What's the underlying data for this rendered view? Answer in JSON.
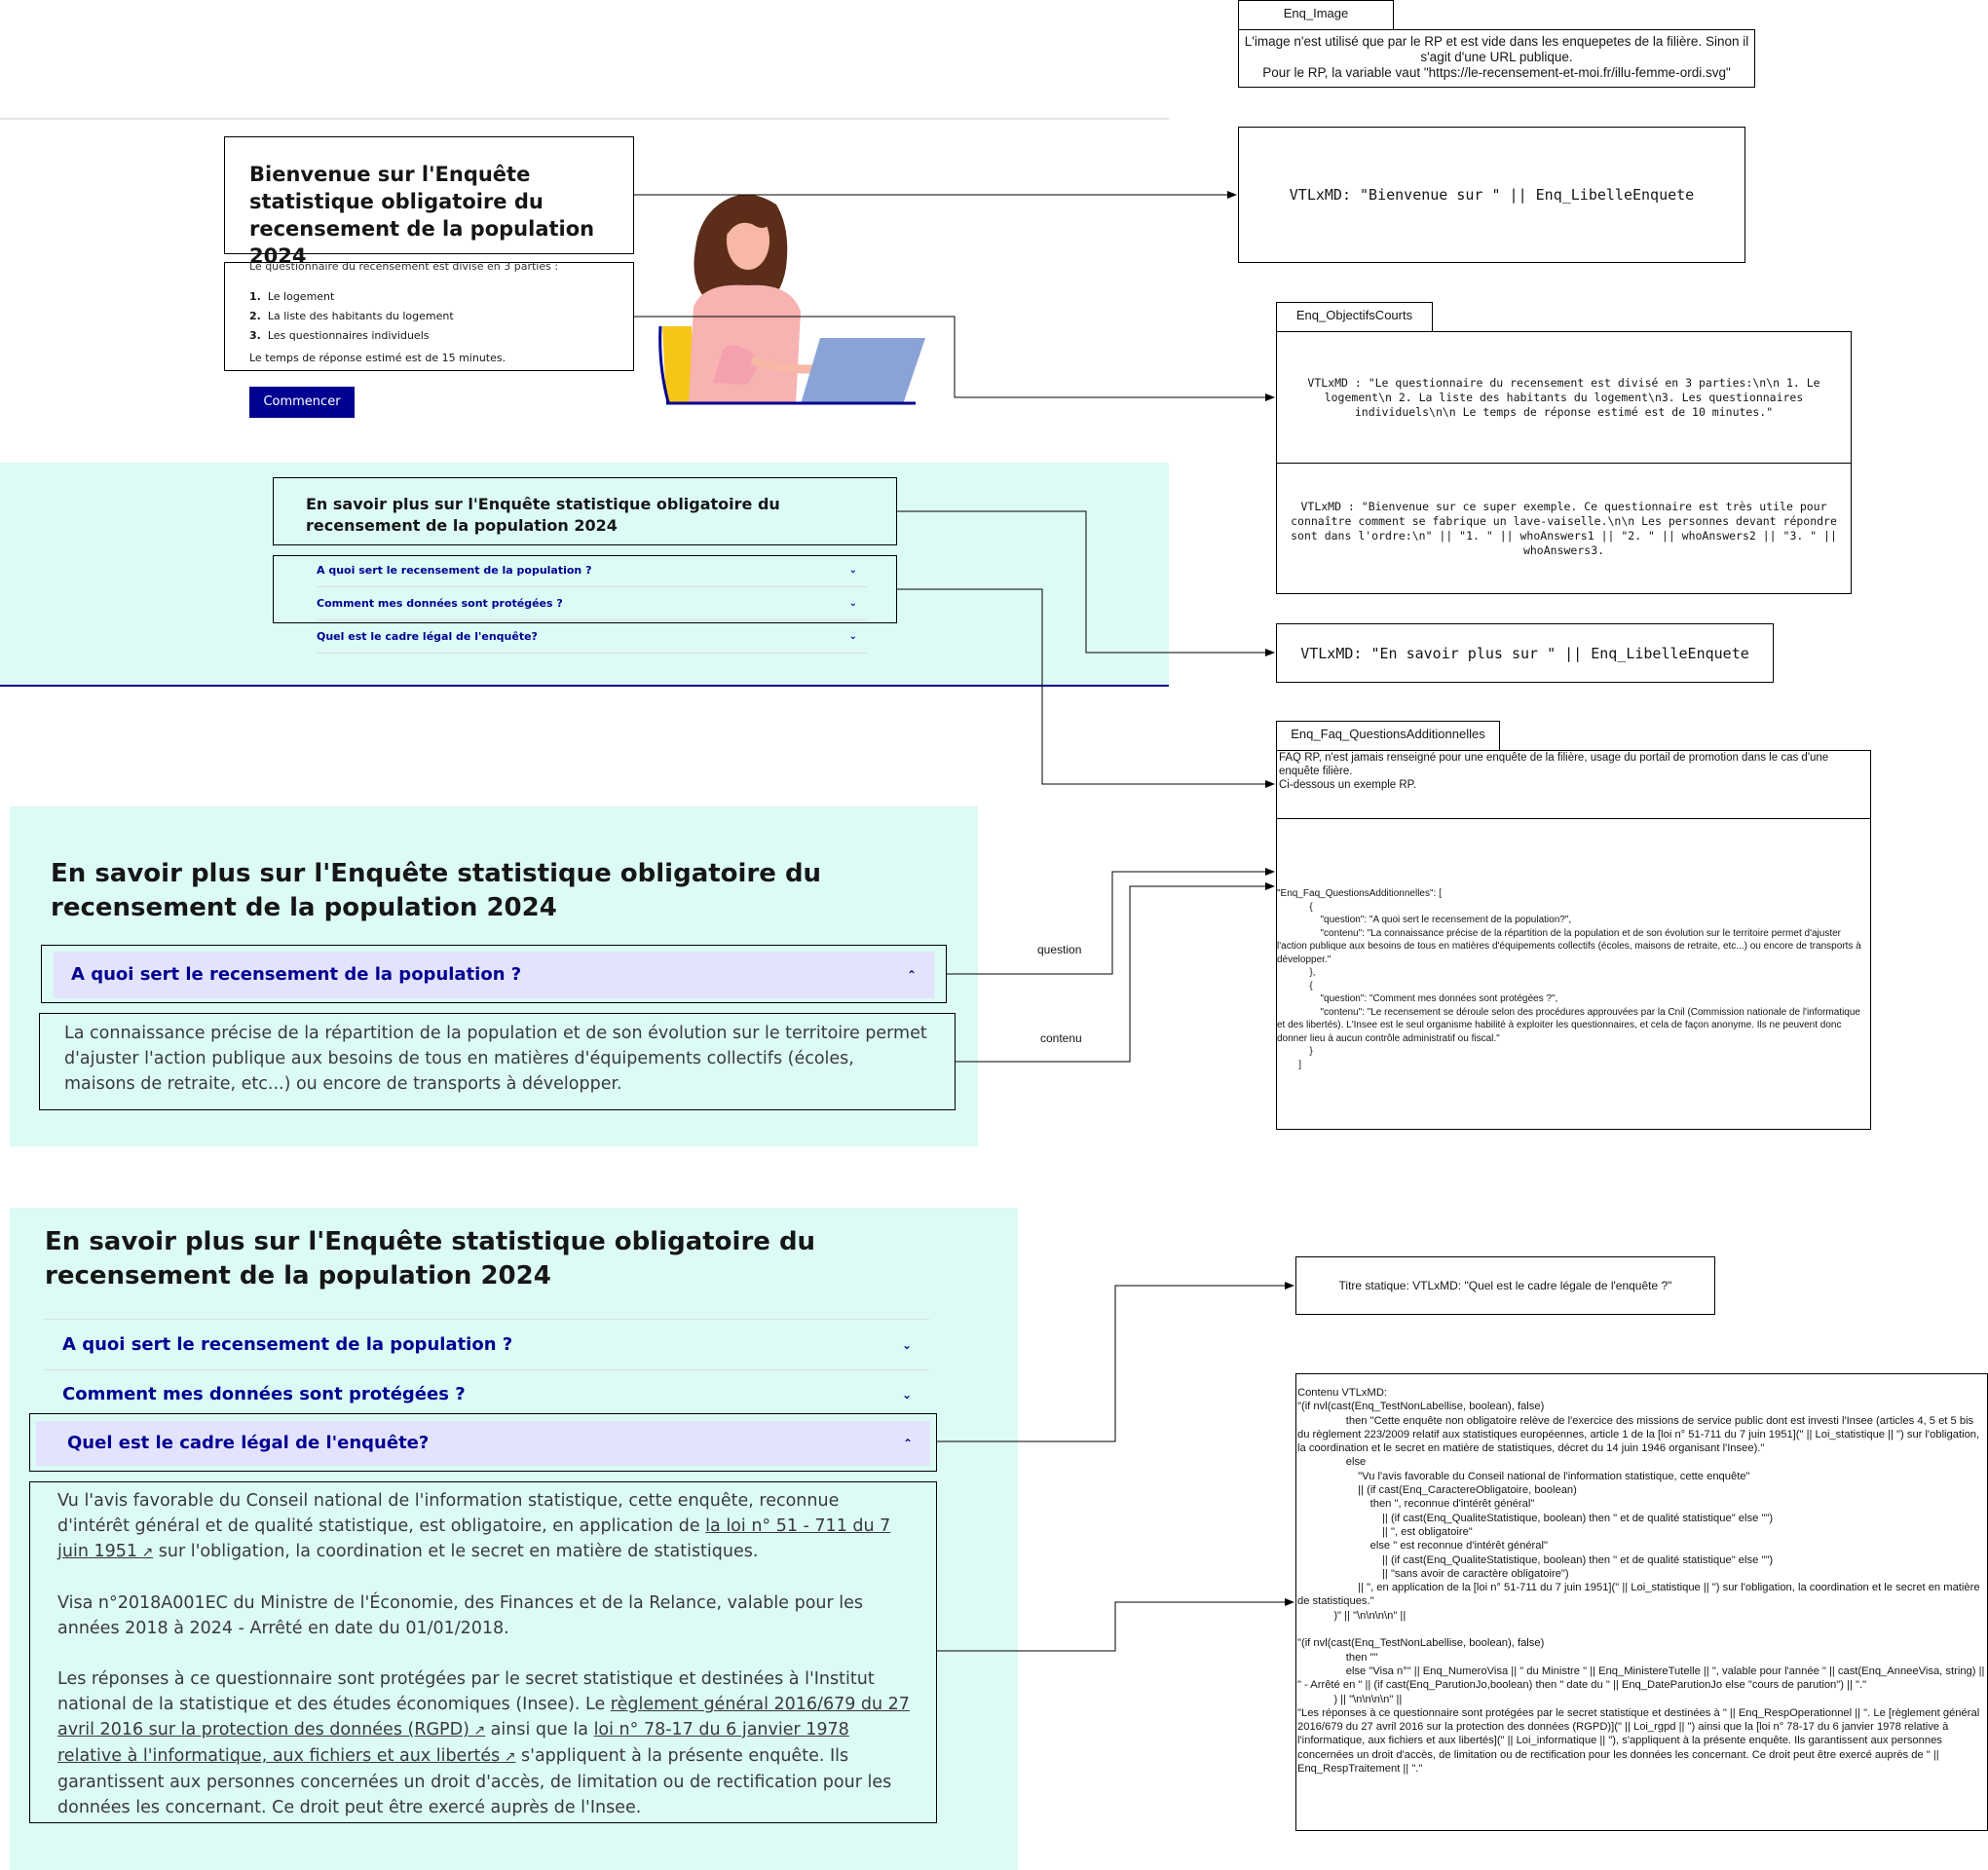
{
  "enq_image": {
    "tab": "Enq_Image",
    "text": "L'image n'est utilisé que par le RP et est vide dans les enquepetes de la filière. Sinon il s'agit d'une URL publique.\nPour le RP, la variable vaut \"https://le-recensement-et-moi.fr/illu-femme-ordi.svg\""
  },
  "welcome": {
    "title": "Bienvenue sur l'Enquête statistique obligatoire du recensement de la population 2024",
    "intro": "Le questionnaire du recensement est divisé en 3 parties :",
    "parts": [
      "Le logement",
      "La liste des habitants du logement",
      "Les questionnaires individuels"
    ],
    "part_numbers": [
      "1.",
      "2.",
      "3."
    ],
    "duration": "Le temps de réponse estimé est de 15 minutes.",
    "start_button": "Commencer"
  },
  "vtl_welcome": "VTLxMD: \"Bienvenue sur \" || Enq_LibelleEnquete",
  "objectifs": {
    "tab": "Enq_ObjectifsCourts",
    "text1": "VTLxMD : \"Le questionnaire du recensement est divisé en 3 parties:\\n\\n 1. Le logement\\n 2. La liste des habitants du logement\\n3. Les questionnaires individuels\\n\\n Le temps de réponse estimé est de 10 minutes.\"",
    "text2": "VTLxMD : \"Bienvenue sur ce super exemple. Ce questionnaire est très utile pour connaître comment se fabrique un lave-vaiselle.\\n\\n Les personnes devant répondre sont dans l'ordre:\\n\" || \"1. \" || whoAnswers1 || \"2. \" || whoAnswers2 || \"3. \" || whoAnswers3."
  },
  "faq_small": {
    "title": "En savoir plus sur l'Enquête statistique obligatoire du recensement de la population 2024",
    "items": [
      "A quoi sert le recensement de la population ?",
      "Comment mes données sont protégées ?",
      "Quel est le cadre légal de l'enquête?"
    ]
  },
  "vtl_savoir": "VTLxMD: \"En savoir plus sur \" || Enq_LibelleEnquete",
  "faq_add": {
    "tab": "Enq_Faq_QuestionsAdditionnelles",
    "text1": "FAQ RP, n'est jamais renseigné pour une enquête de la filière, usage du portail de promotion dans le cas d'une enquête filière.\nCi-dessous un exemple RP.",
    "text2": "\"Enq_Faq_QuestionsAdditionnelles\": [\n            {\n                \"question\": \"A quoi sert le recensement de la population?\",\n                \"contenu\": \"La connaissance précise de la répartition de la population et de son évolution sur le territoire permet d'ajuster l'action publique aux besoins de tous en matières d'équipements collectifs (écoles, maisons de retraite, etc...) ou encore de transports à développer.\"\n            },\n            {\n                \"question\": \"Comment mes données sont protégées ?\",\n                \"contenu\": \"Le recensement se déroule selon des procédures approuvées par la Cnil (Commission nationale de l'informatique et des libertés). L'Insee est le seul organisme habilité à exploiter les questionnaires, et cela de façon anonyme. Ils ne peuvent donc donner lieu à aucun contrôle administratif ou fiscal.\"\n            }\n        ]"
  },
  "faq_mid": {
    "title": "En savoir plus sur l'Enquête statistique obligatoire du recensement de la population 2024",
    "question": "A quoi sert le recensement de la population ?",
    "answer": "La connaissance précise de la répartition de la population et de son évolution sur le territoire permet d'ajuster l'action publique aux besoins de tous en matières d'équipements collectifs (écoles, maisons de retraite, etc...) ou encore de transports à développer."
  },
  "labels": {
    "question": "question",
    "contenu": "contenu"
  },
  "faq_big": {
    "title": "En savoir plus sur l'Enquête statistique obligatoire du recensement de la population 2024",
    "items": [
      "A quoi sert le recensement de la population ?",
      "Comment mes données sont protégées ?",
      "Quel est le cadre légal de l'enquête?"
    ],
    "p1_a": "Vu l'avis favorable du Conseil national de l'information statistique, cette enquête, reconnue d'intérêt général et de qualité statistique, est obligatoire, en application de ",
    "p1_link": "la loi n° 51 - 711 du 7 juin 1951",
    "p1_b": " sur l'obligation, la coordination et le secret en matière de statistiques.",
    "p2": "Visa n°2018A001EC du Ministre de l'Économie, des Finances et de la Relance, valable pour les années 2018 à 2024 - Arrêté en date du 01/01/2018.",
    "p3_a": "Les réponses à ce questionnaire sont protégées par le secret statistique et destinées à l'Institut national de la statistique et des études économiques (Insee). Le ",
    "p3_link1": "règlement général 2016/679 du 27 avril 2016 sur la protection des données (RGPD)",
    "p3_b": " ainsi que la ",
    "p3_link2": "loi n° 78-17 du 6 janvier 1978 relative à l'informatique, aux fichiers et aux libertés",
    "p3_c": " s'appliquent à la présente enquête. Ils garantissent aux personnes concernées un droit d'accès, de limitation ou de rectification pour les données les concernant. Ce droit peut être exercé auprès de l'Insee."
  },
  "titre_statique": "Titre statique: VTLxMD: \"Quel est le cadre légale de l'enquête ?\"",
  "contenu_vtl": "Contenu VTLxMD:\n\"(if nvl(cast(Enq_TestNonLabellise, boolean), false)\n                then \"Cette enquête non obligatoire relève de l'exercice des missions de service public dont est investi l'Insee (articles 4, 5 et 5 bis du règlement 223/2009 relatif aux statistiques européennes, article 1 de la [loi n° 51-711 du 7 juin 1951](\" || Loi_statistique || \") sur l'obligation, la coordination et le secret en matière de statistiques, décret du 14 juin 1946 organisant l'Insee).\"\n                else\n                    \"Vu l'avis favorable du Conseil national de l'information statistique, cette enquête\"\n                    || (if cast(Enq_CaractereObligatoire, boolean)\n                        then \", reconnue d'intérêt général\"\n                            || (if cast(Enq_QualiteStatistique, boolean) then \" et de qualité statistique\" else \"\")\n                            || \", est obligatoire\"\n                        else \" est reconnue d'intérêt général\"\n                            || (if cast(Enq_QualiteStatistique, boolean) then \" et de qualité statistique\" else \"\")\n                            || \"sans avoir de caractère obligatoire\")\n                    || \", en application de la [loi n° 51-711 du 7 juin 1951](\" || Loi_statistique || \") sur l'obligation, la coordination et le secret en matière de statistiques.\"\n            )\" || \"\\n\\n\\n\\n\" ||\n\n\"(if nvl(cast(Enq_TestNonLabellise, boolean), false)\n                then \"\"\n                else \"Visa n°\" || Enq_NumeroVisa || \" du Ministre \" || Enq_MinistereTutelle || \", valable pour l'année \" || cast(Enq_AnneeVisa, string) || \" - Arrêté en \" || (if cast(Enq_ParutionJo,boolean) then \" date du \" || Enq_DateParutionJo else \"cours de parution\") || \".\"\n            ) || \"\\n\\n\\n\\n\" ||\n\"Les réponses à ce questionnaire sont protégées par le secret statistique et destinées à \" || Enq_RespOperationnel || \". Le [règlement général 2016/679 du 27 avril 2016 sur la protection des données (RGPD)](\" || Loi_rgpd || \") ainsi que la [loi n° 78-17 du 6 janvier 1978 relative à l'informatique, aux fichiers et aux libertés](\" || Loi_informatique || \"), s'appliquent à la présente enquête. Ils garantissent aux personnes concernées un droit d'accès, de limitation ou de rectification pour les données les concernant. Ce droit peut être exercé auprès de \" || Enq_RespTraitement || \".\"",
  "colors": {
    "mint": "#dbfbf4",
    "navy": "#000091",
    "lavender": "#e3e3fd"
  },
  "icons": [
    "chevron-down-icon",
    "chevron-up-icon",
    "external-link-icon",
    "woman-laptop-illustration"
  ]
}
